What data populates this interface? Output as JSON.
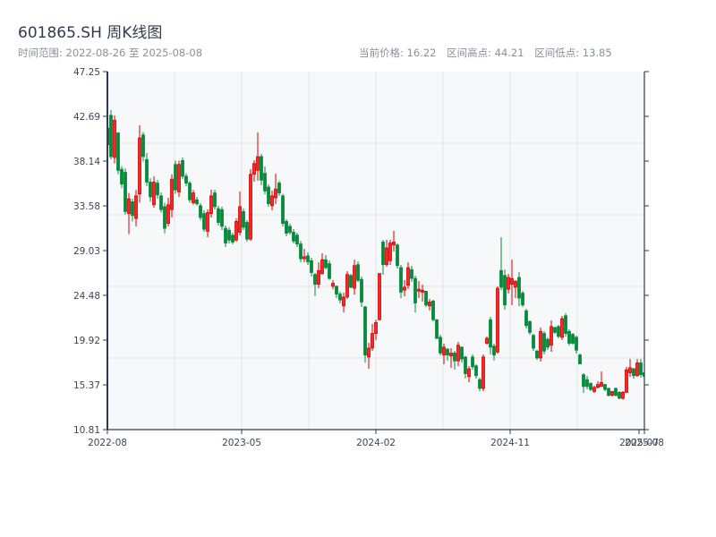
{
  "header": {
    "title": "601865.SH 周K线图",
    "range_label": "时间范围: 2022-08-26 至 2025-08-08",
    "current_price": "当前价格: 16.22",
    "period_high": "区间高点: 44.21",
    "period_low": "区间低点: 13.85"
  },
  "colors": {
    "up": "#d90000",
    "up_fill": "#ee2a2a",
    "down": "#078a3b",
    "axis": "#2e3b4e",
    "grid": "#e1e4e9",
    "plot_bg": "#f7f8fa"
  },
  "chart_data": {
    "type": "candlestick",
    "title": "601865.SH 周K线图",
    "ylim": [
      10.81,
      47.25
    ],
    "yticks": [
      "47.25",
      "42.69",
      "38.14",
      "33.58",
      "29.03",
      "24.48",
      "19.92",
      "15.37",
      "10.81"
    ],
    "xticks": [
      {
        "label": "2022-08",
        "index": 0
      },
      {
        "label": "2023-05",
        "index": 37.5
      },
      {
        "label": "2024-02",
        "index": 75
      },
      {
        "label": "2024-11",
        "index": 112.5
      },
      {
        "label": "2025-07",
        "index": 148.5
      },
      {
        "label": "2025-08",
        "index": 150
      }
    ],
    "grid": true,
    "ohlc_order": [
      "open",
      "high",
      "low",
      "close"
    ],
    "candles": [
      [
        39.8,
        42.0,
        39.5,
        41.5
      ],
      [
        42.8,
        43.33,
        38.32,
        38.6
      ],
      [
        38.5,
        42.8,
        37.9,
        42.3
      ],
      [
        41.0,
        41.1,
        36.8,
        37.2
      ],
      [
        37.3,
        37.6,
        35.4,
        35.8
      ],
      [
        37.0,
        37.4,
        32.7,
        33.0
      ],
      [
        32.8,
        34.9,
        30.7,
        34.3
      ],
      [
        34.0,
        34.3,
        32.0,
        32.6
      ],
      [
        32.3,
        35.2,
        31.5,
        34.6
      ],
      [
        34.8,
        41.8,
        33.9,
        40.5
      ],
      [
        40.8,
        41.1,
        38.1,
        38.6
      ],
      [
        38.3,
        38.96,
        35.6,
        36.0
      ],
      [
        36.0,
        36.4,
        34.0,
        34.5
      ],
      [
        33.7,
        36.6,
        33.4,
        36.0
      ],
      [
        35.9,
        36.2,
        34.3,
        34.7
      ],
      [
        34.6,
        34.95,
        32.9,
        33.2
      ],
      [
        33.5,
        33.9,
        30.8,
        31.3
      ],
      [
        31.8,
        34.4,
        31.5,
        33.7
      ],
      [
        33.2,
        36.8,
        32.4,
        36.3
      ],
      [
        37.8,
        38.2,
        34.8,
        35.2
      ],
      [
        35.0,
        38.2,
        34.5,
        37.8
      ],
      [
        38.2,
        38.5,
        36.3,
        36.6
      ],
      [
        36.6,
        36.9,
        35.6,
        35.9
      ],
      [
        35.9,
        36.1,
        33.9,
        34.2
      ],
      [
        33.9,
        35.2,
        33.7,
        34.9
      ],
      [
        34.2,
        34.5,
        33.6,
        33.8
      ],
      [
        33.6,
        33.86,
        32.13,
        32.4
      ],
      [
        32.8,
        33.13,
        30.94,
        31.2
      ],
      [
        31.0,
        33.22,
        30.4,
        32.9
      ],
      [
        32.8,
        35.22,
        32.4,
        34.6
      ],
      [
        34.9,
        35.22,
        33.22,
        33.5
      ],
      [
        33.3,
        33.6,
        31.58,
        31.9
      ],
      [
        33.2,
        33.5,
        31.13,
        31.5
      ],
      [
        31.3,
        31.58,
        29.39,
        29.8
      ],
      [
        31.1,
        31.4,
        29.76,
        30.1
      ],
      [
        30.6,
        30.85,
        29.67,
        29.9
      ],
      [
        30.1,
        32.31,
        29.94,
        32.0
      ],
      [
        30.9,
        35.04,
        30.58,
        33.5
      ],
      [
        33.0,
        33.31,
        31.13,
        31.4
      ],
      [
        31.9,
        32.13,
        29.94,
        30.2
      ],
      [
        30.2,
        37.32,
        30.03,
        36.8
      ],
      [
        36.8,
        38.23,
        36.04,
        37.9
      ],
      [
        37.2,
        41.05,
        36.14,
        38.6
      ],
      [
        38.6,
        38.87,
        35.68,
        36.2
      ],
      [
        36.9,
        37.59,
        34.77,
        35.1
      ],
      [
        35.5,
        35.77,
        33.49,
        33.8
      ],
      [
        33.6,
        35.13,
        33.13,
        34.6
      ],
      [
        34.4,
        36.86,
        33.77,
        35.3
      ],
      [
        35.9,
        36.14,
        34.59,
        34.9
      ],
      [
        34.6,
        34.8,
        31.49,
        31.8
      ],
      [
        32.0,
        32.22,
        30.49,
        30.8
      ],
      [
        31.5,
        31.76,
        30.67,
        30.9
      ],
      [
        30.9,
        31.22,
        29.76,
        30.0
      ],
      [
        30.6,
        30.85,
        29.4,
        29.7
      ],
      [
        29.7,
        30.03,
        27.85,
        28.2
      ],
      [
        28.2,
        29.21,
        27.85,
        28.4
      ],
      [
        28.5,
        28.85,
        27.57,
        27.9
      ],
      [
        28.0,
        28.3,
        26.39,
        26.8
      ],
      [
        26.6,
        26.75,
        24.38,
        25.6
      ],
      [
        25.6,
        27.85,
        25.2,
        27.0
      ],
      [
        26.7,
        28.76,
        26.57,
        28.1
      ],
      [
        28.1,
        28.58,
        27.12,
        27.3
      ],
      [
        27.7,
        28.03,
        26.03,
        26.2
      ],
      [
        25.4,
        26.03,
        25.11,
        25.7
      ],
      [
        25.4,
        25.48,
        24.2,
        24.6
      ],
      [
        24.6,
        24.84,
        23.65,
        24.0
      ],
      [
        23.4,
        24.75,
        22.74,
        24.3
      ],
      [
        24.3,
        26.93,
        24.11,
        26.6
      ],
      [
        26.5,
        26.66,
        25.2,
        25.3
      ],
      [
        25.2,
        28.12,
        24.56,
        27.5
      ],
      [
        27.6,
        27.94,
        25.84,
        26.0
      ],
      [
        26.1,
        26.39,
        23.29,
        23.8
      ],
      [
        23.3,
        23.4,
        17.64,
        18.4
      ],
      [
        18.2,
        19.65,
        17.0,
        19.1
      ],
      [
        19.1,
        21.56,
        18.83,
        20.6
      ],
      [
        20.6,
        22.0,
        19.9,
        21.7
      ],
      [
        22.0,
        26.75,
        21.92,
        26.7
      ],
      [
        29.9,
        30.12,
        26.57,
        27.6
      ],
      [
        27.6,
        30.12,
        27.39,
        29.3
      ],
      [
        28.0,
        30.12,
        27.57,
        29.8
      ],
      [
        29.6,
        31.03,
        28.94,
        29.9
      ],
      [
        29.6,
        29.76,
        27.21,
        27.5
      ],
      [
        27.3,
        27.57,
        24.2,
        24.8
      ],
      [
        25.0,
        26.03,
        24.38,
        25.3
      ],
      [
        25.5,
        27.85,
        25.11,
        27.3
      ],
      [
        27.1,
        27.48,
        25.84,
        26.2
      ],
      [
        26.2,
        26.48,
        22.74,
        23.7
      ],
      [
        24.9,
        25.93,
        24.2,
        25.1
      ],
      [
        24.8,
        25.57,
        23.84,
        25.0
      ],
      [
        24.9,
        24.93,
        23.29,
        23.5
      ],
      [
        23.4,
        24.11,
        22.93,
        23.8
      ],
      [
        23.9,
        24.02,
        21.83,
        22.0
      ],
      [
        22.0,
        22.02,
        20.01,
        20.1
      ],
      [
        20.2,
        20.47,
        18.37,
        18.6
      ],
      [
        18.4,
        19.56,
        17.46,
        19.2
      ],
      [
        19.0,
        19.1,
        17.82,
        18.4
      ],
      [
        18.3,
        19.1,
        17.1,
        18.6
      ],
      [
        18.6,
        18.83,
        16.91,
        17.8
      ],
      [
        17.8,
        19.74,
        17.28,
        19.4
      ],
      [
        19.2,
        19.28,
        17.64,
        18.0
      ],
      [
        18.2,
        18.3,
        16.0,
        16.5
      ],
      [
        16.2,
        17.28,
        15.64,
        17.0
      ],
      [
        18.2,
        18.46,
        16.91,
        17.2
      ],
      [
        17.3,
        17.46,
        16.0,
        16.3
      ],
      [
        15.9,
        16.09,
        14.73,
        15.0
      ],
      [
        15.0,
        18.46,
        14.73,
        18.2
      ],
      [
        19.6,
        20.28,
        19.46,
        20.1
      ],
      [
        22.0,
        22.29,
        18.46,
        19.2
      ],
      [
        19.3,
        19.56,
        17.82,
        18.4
      ],
      [
        18.7,
        25.39,
        18.55,
        25.2
      ],
      [
        27.0,
        30.4,
        25.0,
        25.3
      ],
      [
        26.5,
        27.12,
        23.02,
        23.5
      ],
      [
        25.1,
        26.66,
        24.66,
        26.3
      ],
      [
        25.6,
        28.12,
        23.47,
        26.2
      ],
      [
        25.3,
        26.03,
        24.2,
        25.9
      ],
      [
        26.3,
        26.84,
        23.38,
        24.2
      ],
      [
        24.7,
        24.93,
        23.29,
        23.5
      ],
      [
        22.9,
        23.11,
        21.1,
        21.4
      ],
      [
        21.8,
        21.92,
        20.47,
        20.7
      ],
      [
        20.4,
        20.56,
        18.83,
        19.1
      ],
      [
        18.8,
        18.92,
        17.92,
        18.1
      ],
      [
        18.1,
        21.19,
        17.73,
        20.8
      ],
      [
        20.6,
        20.83,
        18.46,
        18.8
      ],
      [
        20.0,
        20.19,
        18.92,
        19.2
      ],
      [
        19.4,
        21.92,
        18.74,
        21.3
      ],
      [
        21.2,
        21.29,
        20.56,
        20.7
      ],
      [
        21.3,
        21.47,
        20.1,
        20.3
      ],
      [
        20.2,
        22.38,
        19.92,
        22.1
      ],
      [
        22.4,
        22.65,
        20.28,
        20.6
      ],
      [
        20.8,
        21.01,
        19.37,
        19.6
      ],
      [
        20.5,
        20.65,
        19.46,
        19.6
      ],
      [
        20.2,
        20.37,
        18.55,
        18.9
      ],
      [
        18.4,
        18.55,
        17.46,
        17.5
      ],
      [
        16.4,
        16.55,
        14.55,
        15.2
      ],
      [
        15.9,
        16.28,
        14.91,
        15.2
      ],
      [
        15.5,
        15.64,
        14.73,
        14.9
      ],
      [
        14.7,
        15.27,
        14.55,
        15.1
      ],
      [
        15.1,
        15.73,
        15.0,
        15.4
      ],
      [
        15.2,
        16.73,
        15.18,
        15.6
      ],
      [
        15.4,
        15.46,
        14.73,
        14.9
      ],
      [
        15.0,
        15.09,
        14.18,
        14.3
      ],
      [
        14.3,
        14.73,
        14.18,
        14.7
      ],
      [
        15.0,
        15.09,
        14.18,
        14.3
      ],
      [
        14.6,
        14.73,
        13.91,
        14.0
      ],
      [
        14.0,
        14.73,
        13.85,
        14.6
      ],
      [
        14.6,
        17.19,
        14.55,
        16.9
      ],
      [
        16.6,
        18.01,
        16.19,
        17.1
      ],
      [
        17.0,
        17.1,
        16.0,
        16.3
      ],
      [
        16.3,
        18.0,
        16.2,
        17.6
      ],
      [
        17.6,
        18.0,
        16.1,
        16.4
      ],
      [
        16.6,
        16.7,
        16.1,
        16.22
      ]
    ]
  }
}
